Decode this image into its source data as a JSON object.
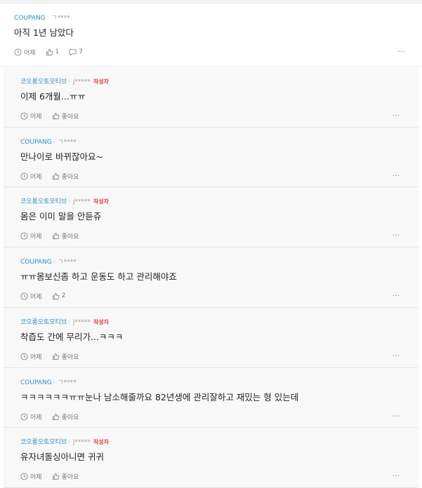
{
  "time_icon": "clock-icon",
  "like_icon": "thumbs-up-icon",
  "reply_icon": "speech-bubble-icon",
  "more_icon": "ellipsis-icon",
  "colors": {
    "author": "#2e8fc9",
    "writer_badge": "#e03b3b",
    "reply_bg": "#f8f8f8"
  },
  "main_comment": {
    "author": "COUPANG",
    "sep": "·",
    "user": "ㄱ****",
    "text": "아직 1년 남았다",
    "time": "어제",
    "likes": "1",
    "replies": "7",
    "more": "···"
  },
  "replies": [
    {
      "author": "코오롱오토모티브",
      "sep": "·",
      "user": "j*****",
      "badge": "작성자",
      "text": "이제 6개월...ㅠㅠ",
      "time": "어제",
      "likes": "좋아요",
      "more": "···"
    },
    {
      "author": "COUPANG",
      "sep": "·",
      "user": "ㄱ****",
      "badge": "",
      "text": "만나이로 바뀌잖아요~",
      "time": "어제",
      "likes": "좋아요",
      "more": "···"
    },
    {
      "author": "코오롱오토모티브",
      "sep": "·",
      "user": "j*****",
      "badge": "작성자",
      "text": "몸은 이미 말을 안듣쥬",
      "time": "어제",
      "likes": "좋아요",
      "more": "···"
    },
    {
      "author": "COUPANG",
      "sep": "·",
      "user": "ㄱ****",
      "badge": "",
      "text": "ㅠㅠ몸보신좀 하고 운동도 하고 관리해야죠",
      "time": "어제",
      "likes": "2",
      "more": "···"
    },
    {
      "author": "코오롱오토모티브",
      "sep": "·",
      "user": "j*****",
      "badge": "작성자",
      "text": "착즙도 간에 무리가...ㅋㅋㅋ",
      "time": "어제",
      "likes": "좋아요",
      "more": "···"
    },
    {
      "author": "COUPANG",
      "sep": "·",
      "user": "ㄱ****",
      "badge": "",
      "text": "ㅋㅋㅋㅋㅋㅋㅠㅠ눈나 남소해줄까요 82년생에 관리잘하고 재밌는 형 있는데",
      "time": "어제",
      "likes": "좋아요",
      "more": "···"
    },
    {
      "author": "코오롱오토모티브",
      "sep": "·",
      "user": "j*****",
      "badge": "작성자",
      "text": "유자녀돌싱아니면 귀귀",
      "time": "어제",
      "likes": "좋아요",
      "more": "···"
    }
  ]
}
